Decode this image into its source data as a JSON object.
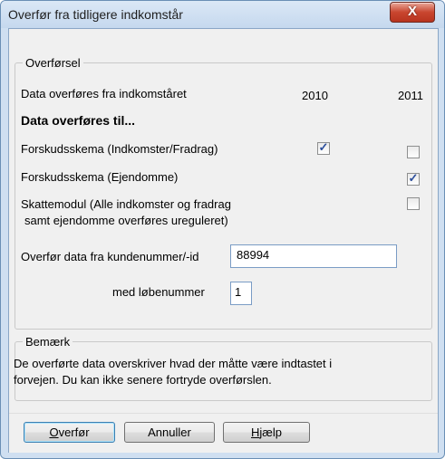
{
  "window": {
    "title": "Overfør fra tidligere indkomstår",
    "close_glyph": "X"
  },
  "transfer_group": {
    "legend": "Overførsel",
    "from_year_label": "Data overføres fra indkomståret",
    "year_a": "2010",
    "year_b": "2011",
    "to_heading": "Data overføres til...",
    "rows": [
      {
        "label": "Forskudsskema (Indkomster/Fradrag)",
        "col_a": true,
        "col_b": false
      },
      {
        "label": "Forskudsskema (Ejendomme)",
        "col_b": true
      },
      {
        "label_line1": "Skattemodul (Alle indkomster og fradrag",
        "label_line2": "samt ejendomme overføres ureguleret)",
        "col_b": false
      }
    ],
    "customer_label": "Overfør data fra kundenummer/-id",
    "customer_value": "88994",
    "sequence_label": "med løbenummer",
    "sequence_value": "1"
  },
  "note_group": {
    "legend": "Bemærk",
    "line1": "De overførte data overskriver hvad der måtte være indtastet i",
    "line2": "forvejen. Du kan ikke senere fortryde overførslen."
  },
  "buttons": {
    "transfer_first": "O",
    "transfer_rest": "verfør",
    "cancel": "Annuller",
    "help_first": "H",
    "help_rest": "jælp"
  },
  "check_glyph": "✓"
}
